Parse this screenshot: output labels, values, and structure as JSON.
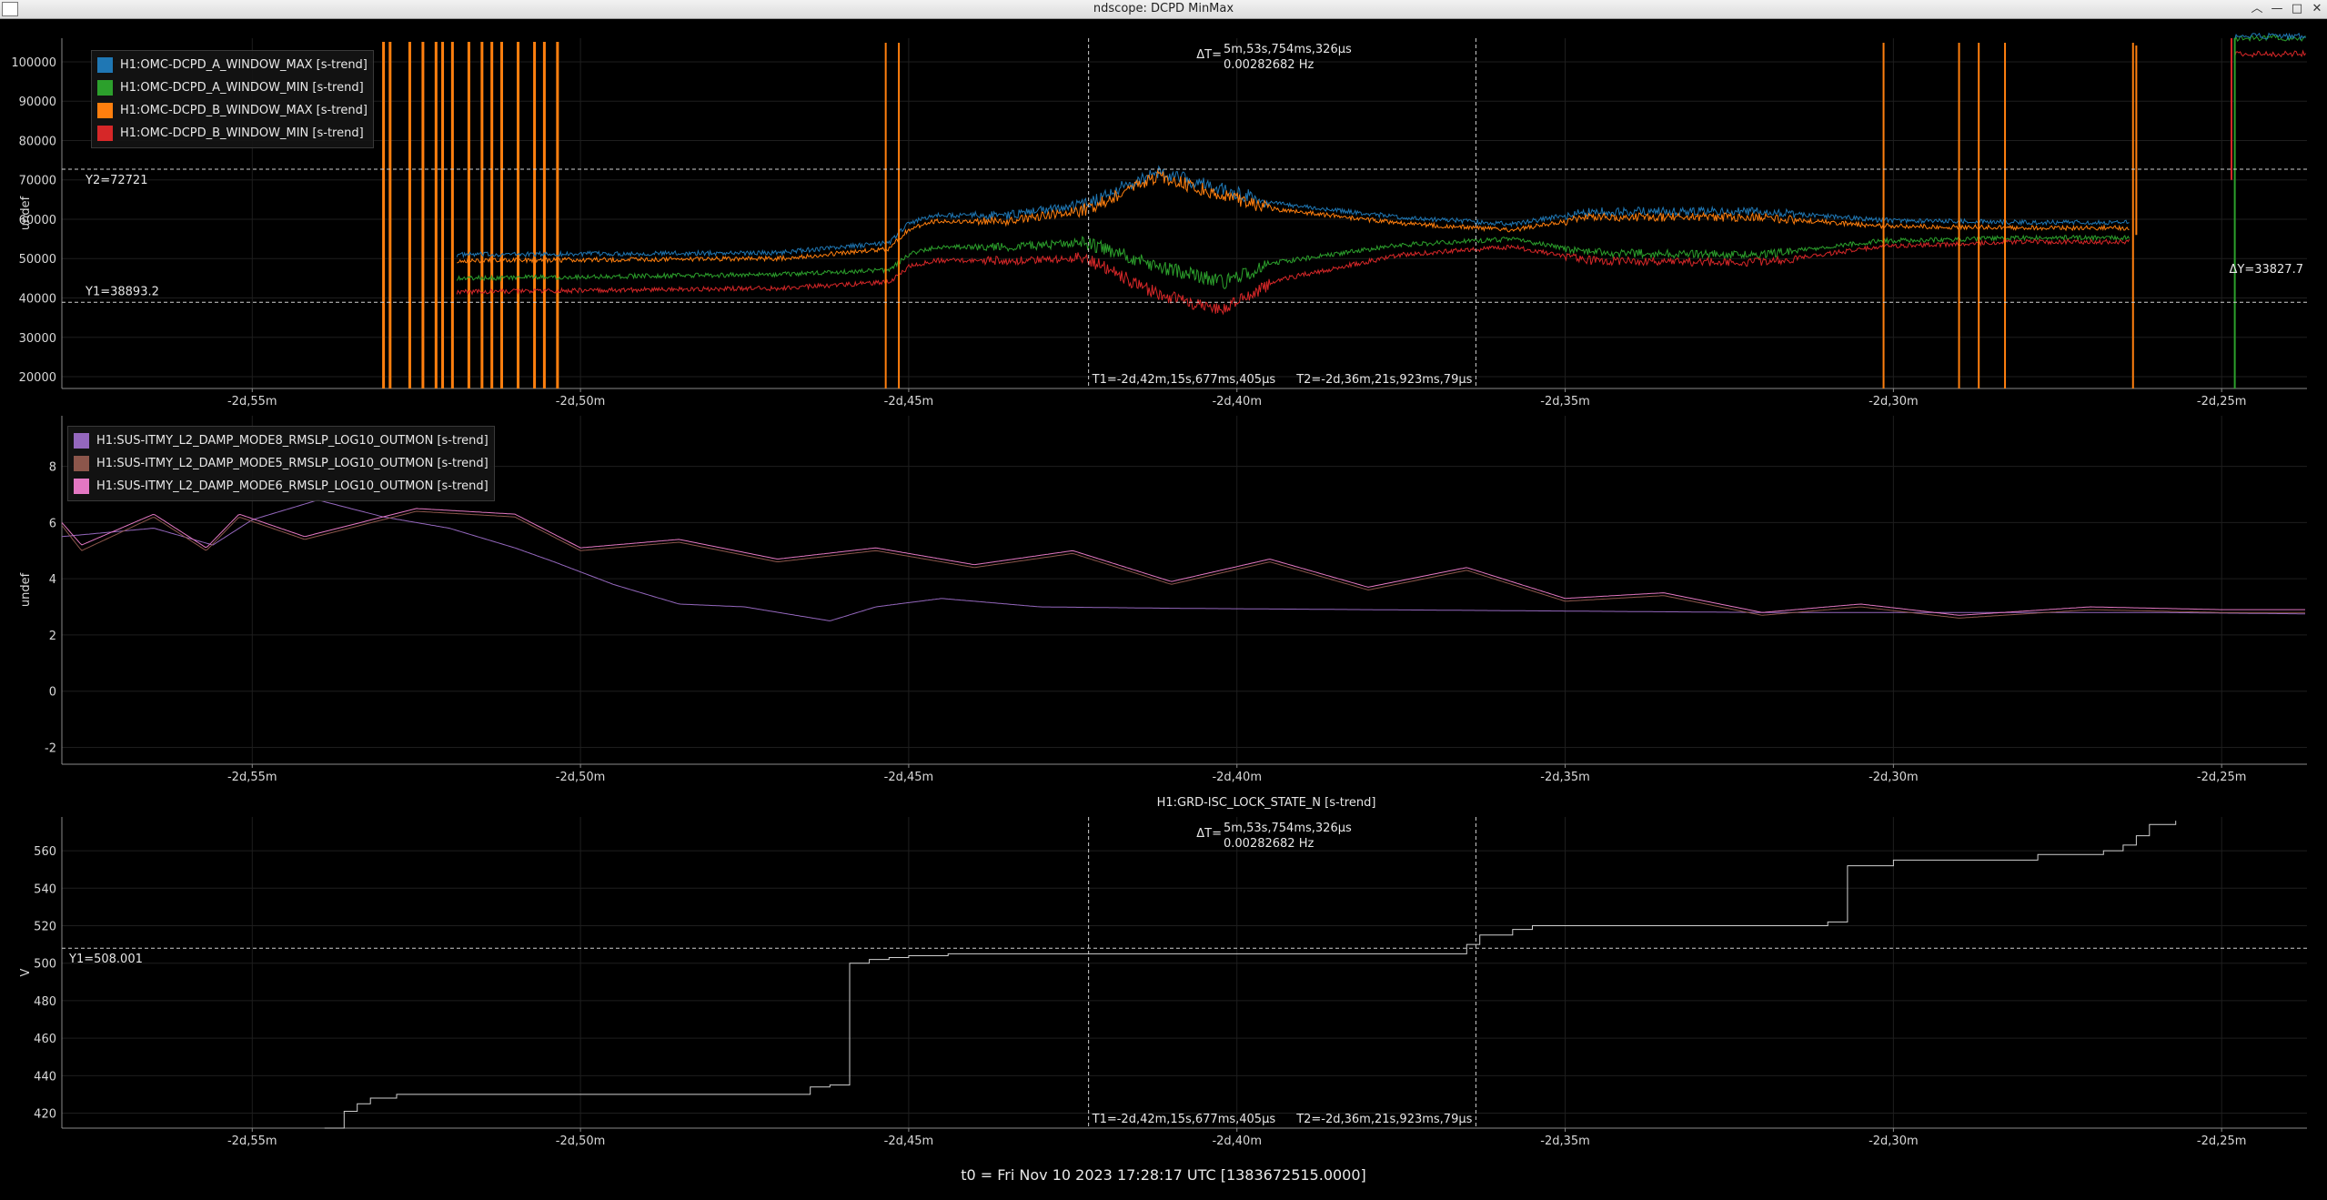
{
  "window": {
    "title": "ndscope: DCPD MinMax",
    "buttons": [
      "︿",
      "—",
      "□",
      "✕"
    ]
  },
  "footer": {
    "t0": "t0 = Fri Nov 10 2023 17:28:17 UTC [1383672515.0000]"
  },
  "cursors": {
    "t1_label": "T1=-2d,42m,15s,677ms,405µs",
    "t2_label": "T2=-2d,36m,21s,923ms,79µs",
    "dt_label": "ΔT=",
    "dt_value": "5m,53s,754ms,326µs",
    "dt_freq": "0.00282682 Hz",
    "t1": -42.26,
    "t2": -36.36
  },
  "x_ticks": [
    "-2d,55m",
    "-2d,50m",
    "-2d,45m",
    "-2d,40m",
    "-2d,35m",
    "-2d,30m",
    "-2d,25m"
  ],
  "chart_data": [
    {
      "type": "line",
      "ylabel": "undef",
      "y_ticks": [
        "100000",
        "90000",
        "80000",
        "70000",
        "60000",
        "50000",
        "40000",
        "30000",
        "20000"
      ],
      "ylim": [
        17000,
        106000
      ],
      "grid": true,
      "legend_position": "top-left",
      "y1_label": "Y1=38893.2",
      "y2_label": "Y2=72721",
      "dy_label": "ΔY=33827.7",
      "y1": 38893.2,
      "y2": 72721,
      "series": [
        {
          "name": "H1:OMC-DCPD_A_WINDOW_MAX [s-trend]",
          "color": "#1f77b4",
          "x": [
            -55.5,
            -53.0,
            -51.9,
            -47.0,
            -45.3,
            -45.0,
            -44.6,
            -43.5,
            -42.3,
            -41.2,
            -40.2,
            -39.4,
            -37.5,
            -35.8,
            -34.6,
            -32.0,
            -30.2,
            -28.0,
            -26.4,
            -26.2
          ],
          "y": [
            null,
            null,
            51000,
            51500,
            54000,
            59000,
            61000,
            61000,
            64000,
            72000,
            67500,
            64000,
            60500,
            58800,
            62000,
            62000,
            59800,
            59200,
            59200,
            null
          ]
        },
        {
          "name": "H1:OMC-DCPD_A_WINDOW_MIN [s-trend]",
          "color": "#2ca02c",
          "x": [
            -55.5,
            -53.0,
            -51.9,
            -47.0,
            -45.3,
            -45.0,
            -44.6,
            -43.5,
            -42.3,
            -41.2,
            -40.2,
            -39.4,
            -37.5,
            -35.8,
            -34.6,
            -32.0,
            -30.2,
            -28.0,
            -26.4,
            -26.2
          ],
          "y": [
            null,
            null,
            45000,
            46000,
            47000,
            51000,
            53000,
            53000,
            54000,
            48000,
            44000,
            49000,
            53500,
            55000,
            51500,
            51000,
            54500,
            55300,
            55300,
            null
          ]
        },
        {
          "name": "H1:OMC-DCPD_B_WINDOW_MAX [s-trend]",
          "color": "#ff7f0e",
          "x": [
            -55.5,
            -53.0,
            -51.9,
            -47.0,
            -45.3,
            -45.0,
            -44.6,
            -43.5,
            -42.3,
            -41.2,
            -40.2,
            -39.4,
            -37.5,
            -35.8,
            -34.6,
            -32.0,
            -30.2,
            -28.0,
            -26.4,
            -26.2
          ],
          "y": [
            null,
            null,
            49500,
            50000,
            52500,
            57500,
            59500,
            59500,
            62500,
            71000,
            66000,
            62500,
            59000,
            57300,
            60500,
            60500,
            58300,
            57800,
            57800,
            null
          ]
        },
        {
          "name": "H1:OMC-DCPD_B_WINDOW_MIN [s-trend]",
          "color": "#d62728",
          "x": [
            -55.5,
            -53.0,
            -51.9,
            -47.0,
            -45.3,
            -45.0,
            -44.6,
            -43.5,
            -42.3,
            -41.2,
            -40.2,
            -39.4,
            -37.5,
            -35.8,
            -34.6,
            -32.0,
            -30.2,
            -28.0,
            -26.4,
            -26.2
          ],
          "y": [
            null,
            null,
            41500,
            42500,
            44000,
            48000,
            49500,
            49500,
            50000,
            41000,
            37000,
            44500,
            51000,
            53000,
            49500,
            49000,
            53000,
            54300,
            54300,
            null
          ]
        }
      ]
    },
    {
      "type": "line",
      "ylabel": "undef",
      "y_ticks": [
        "8",
        "6",
        "4",
        "2",
        "0",
        "-2"
      ],
      "ylim": [
        -2.6,
        9.8
      ],
      "grid": true,
      "legend_position": "top-left",
      "series": [
        {
          "name": "H1:SUS-ITMY_L2_DAMP_MODE8_RMSLP_LOG10_OUTMON [s-trend]",
          "color": "#9467bd",
          "x": [
            -57.9,
            -56.5,
            -55.6,
            -55.0,
            -54.0,
            -53.0,
            -52.0,
            -51.0,
            -50.4,
            -49.5,
            -48.5,
            -47.5,
            -46.2,
            -45.5,
            -44.5,
            -43.0,
            -41.0,
            -38.0,
            -35.0,
            -32.0,
            -29.0,
            -26.0,
            -23.7
          ],
          "y": [
            5.5,
            5.8,
            5.2,
            6.1,
            6.8,
            6.2,
            5.8,
            5.1,
            4.6,
            3.8,
            3.1,
            3.0,
            2.5,
            3.0,
            3.3,
            3.0,
            2.95,
            2.9,
            2.85,
            2.8,
            2.8,
            2.8,
            2.75
          ]
        },
        {
          "name": "H1:SUS-ITMY_L2_DAMP_MODE5_RMSLP_LOG10_OUTMON [s-trend]",
          "color": "#8c564b",
          "x": [
            -57.9,
            -57.6,
            -56.5,
            -55.7,
            -55.2,
            -54.2,
            -52.5,
            -51.0,
            -50.0,
            -48.5,
            -47.0,
            -45.5,
            -44.0,
            -42.5,
            -41.0,
            -39.5,
            -38.0,
            -36.5,
            -35.0,
            -33.5,
            -32.0,
            -30.5,
            -29.0,
            -27.0,
            -25.0,
            -23.7
          ],
          "y": [
            5.9,
            5.0,
            6.2,
            5.0,
            6.2,
            5.4,
            6.4,
            6.2,
            5.0,
            5.3,
            4.6,
            5.0,
            4.4,
            4.9,
            3.8,
            4.6,
            3.6,
            4.3,
            3.2,
            3.4,
            2.7,
            3.0,
            2.6,
            2.9,
            2.8,
            2.8
          ]
        },
        {
          "name": "H1:SUS-ITMY_L2_DAMP_MODE6_RMSLP_LOG10_OUTMON [s-trend]",
          "color": "#e377c2",
          "x": [
            -57.9,
            -57.6,
            -56.5,
            -55.7,
            -55.2,
            -54.2,
            -52.5,
            -51.0,
            -50.0,
            -48.5,
            -47.0,
            -45.5,
            -44.0,
            -42.5,
            -41.0,
            -39.5,
            -38.0,
            -36.5,
            -35.0,
            -33.5,
            -32.0,
            -30.5,
            -29.0,
            -27.0,
            -25.0,
            -23.7
          ],
          "y": [
            6.0,
            5.2,
            6.3,
            5.1,
            6.3,
            5.5,
            6.5,
            6.3,
            5.1,
            5.4,
            4.7,
            5.1,
            4.5,
            5.0,
            3.9,
            4.7,
            3.7,
            4.4,
            3.3,
            3.5,
            2.8,
            3.1,
            2.7,
            3.0,
            2.9,
            2.9
          ]
        }
      ]
    },
    {
      "type": "line",
      "title": "H1:GRD-ISC_LOCK_STATE_N [s-trend]",
      "ylabel": "V",
      "y_ticks": [
        "560",
        "540",
        "520",
        "500",
        "480",
        "460",
        "440",
        "420"
      ],
      "ylim": [
        412,
        578
      ],
      "grid": true,
      "y1_label": "Y1=508.001",
      "y1": 508.001,
      "step": true,
      "series": [
        {
          "name": "H1:GRD-ISC_LOCK_STATE_N [s-trend]",
          "color": "#d0d0d0",
          "x": [
            -53.9,
            -53.6,
            -53.4,
            -53.2,
            -52.8,
            -46.5,
            -46.2,
            -45.9,
            -45.6,
            -45.3,
            -45.0,
            -44.4,
            -36.5,
            -36.3,
            -35.8,
            -35.5,
            -31.0,
            -30.7,
            -30.0,
            -27.8,
            -26.8,
            -26.5,
            -26.3,
            -26.1,
            -25.7
          ],
          "y": [
            412,
            421,
            425,
            428,
            430,
            434,
            435,
            500,
            502,
            503,
            504,
            505,
            510,
            515,
            518,
            520,
            522,
            552,
            555,
            558,
            560,
            563,
            568,
            574,
            576
          ]
        }
      ]
    }
  ]
}
